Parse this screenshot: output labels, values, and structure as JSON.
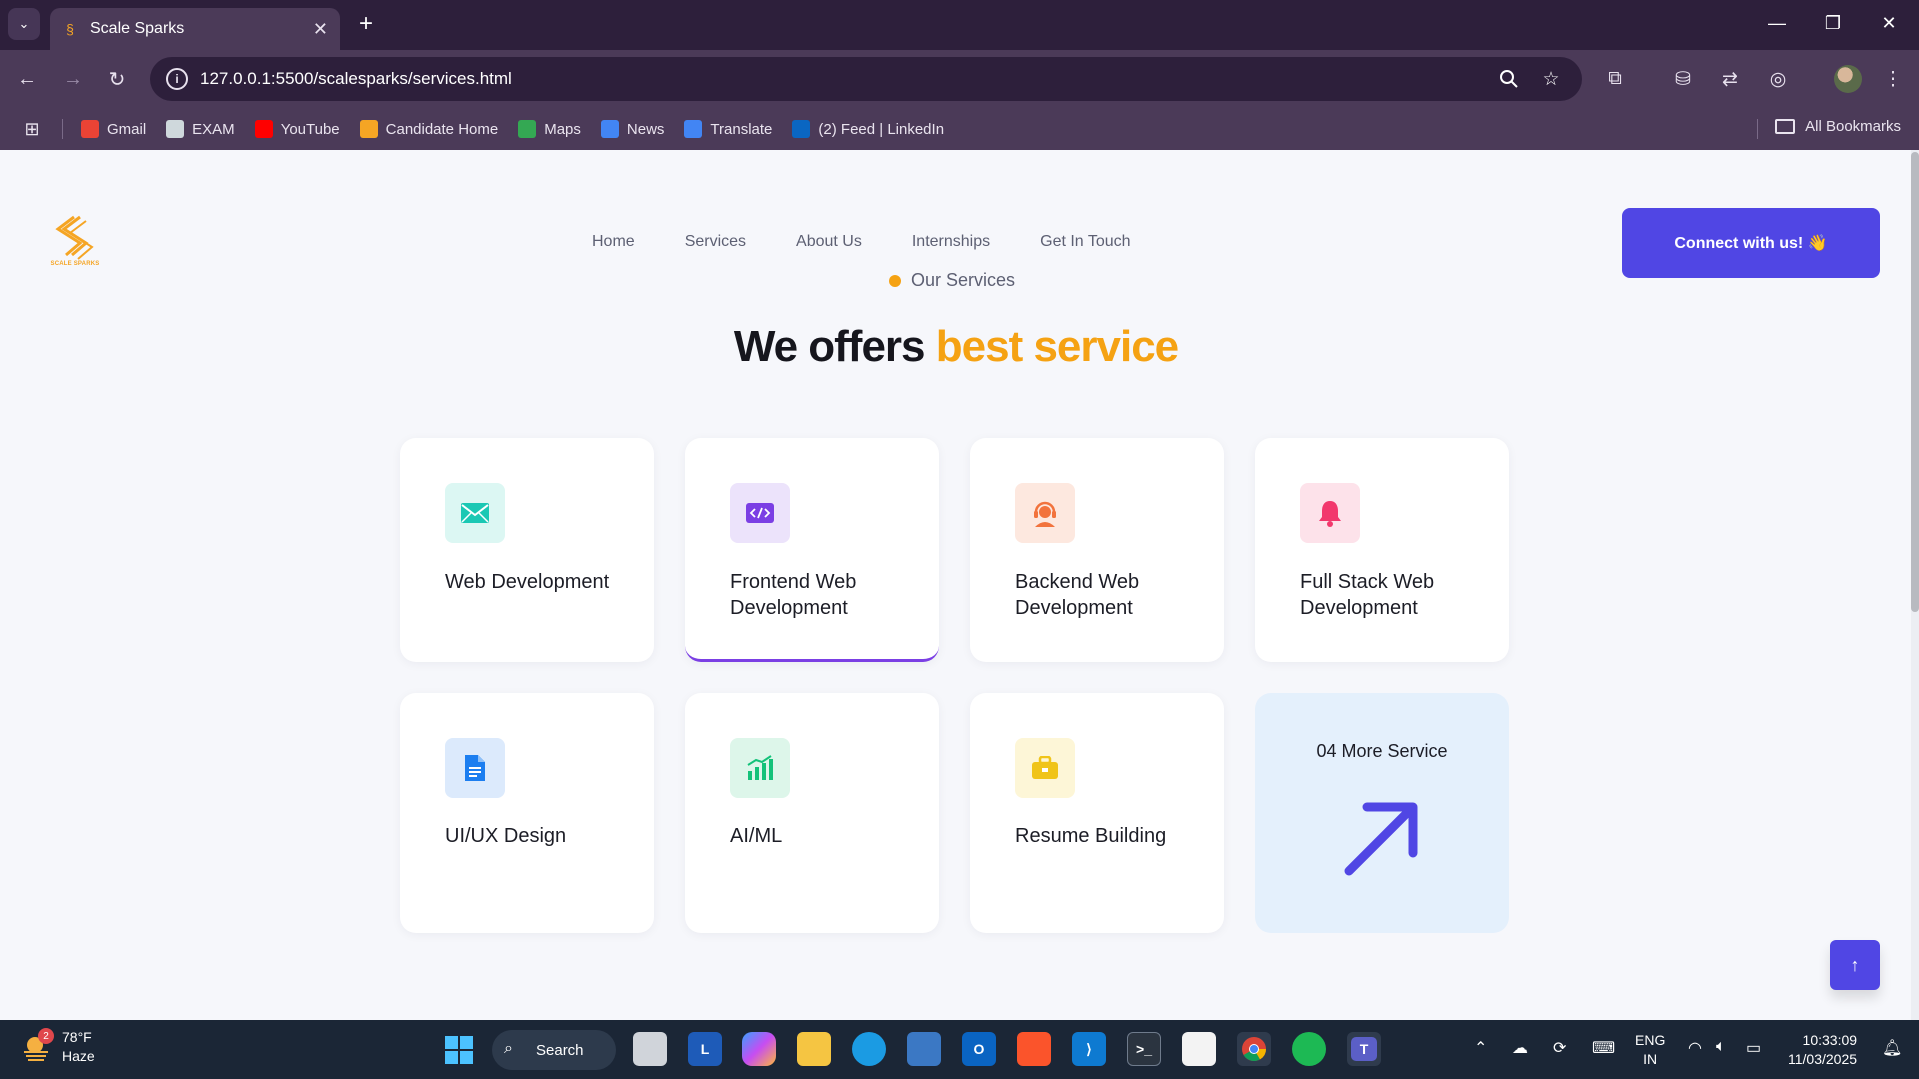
{
  "browser": {
    "tab_title": "Scale Sparks",
    "url": "127.0.0.1:5500/scalesparks/services.html",
    "bookmarks": [
      {
        "label": "Gmail",
        "color": "#ea4335",
        "icon": "gmail-icon"
      },
      {
        "label": "EXAM",
        "color": "#cfd8dc",
        "icon": "exam-icon"
      },
      {
        "label": "YouTube",
        "color": "#ff0000",
        "icon": "youtube-icon"
      },
      {
        "label": "Candidate Home",
        "color": "#f5a524",
        "icon": "candidate-home-icon"
      },
      {
        "label": "Maps",
        "color": "#34a853",
        "icon": "maps-icon"
      },
      {
        "label": "News",
        "color": "#4285f4",
        "icon": "news-icon"
      },
      {
        "label": "Translate",
        "color": "#4285f4",
        "icon": "translate-icon"
      },
      {
        "label": "(2) Feed | LinkedIn",
        "color": "#0a66c2",
        "icon": "linkedin-icon"
      }
    ],
    "all_bookmarks_label": "All Bookmarks"
  },
  "site": {
    "logo_caption": "SCALE SPARKS",
    "nav": [
      "Home",
      "Services",
      "About Us",
      "Internships",
      "Get In Touch"
    ],
    "cta_label": "Connect with us! 👋",
    "eyebrow": "Our Services",
    "headline_main": "We offers ",
    "headline_accent": "best service",
    "accent_color": "#f5a213",
    "brand_color": "#5046e4",
    "services": [
      {
        "label": "Web Development",
        "icon": "envelope-icon",
        "icon_color": "#1bc8b4",
        "bg": "#dcf7f3"
      },
      {
        "label": "Frontend Web Development",
        "icon": "code-icon",
        "icon_color": "#7b3fe4",
        "bg": "#ece3fb"
      },
      {
        "label": "Backend Web Development",
        "icon": "support-agent-icon",
        "icon_color": "#f2733d",
        "bg": "#fde8df"
      },
      {
        "label": "Full Stack Web Development",
        "icon": "bell-icon",
        "icon_color": "#f2386d",
        "bg": "#fde2ea"
      },
      {
        "label": "UI/UX Design",
        "icon": "document-icon",
        "icon_color": "#1c7ef0",
        "bg": "#dceafc"
      },
      {
        "label": "AI/ML",
        "icon": "bar-chart-icon",
        "icon_color": "#14c27a",
        "bg": "#ddf6ea"
      },
      {
        "label": "Resume Building",
        "icon": "briefcase-icon",
        "icon_color": "#f0c419",
        "bg": "#fdf6d7"
      }
    ],
    "more_label": "04 More Service"
  },
  "taskbar": {
    "weather_temp": "78°F",
    "weather_desc": "Haze",
    "weather_badge": "2",
    "search_label": "Search",
    "lang_top": "ENG",
    "lang_bottom": "IN",
    "time": "10:33:09",
    "date": "11/03/2025"
  }
}
